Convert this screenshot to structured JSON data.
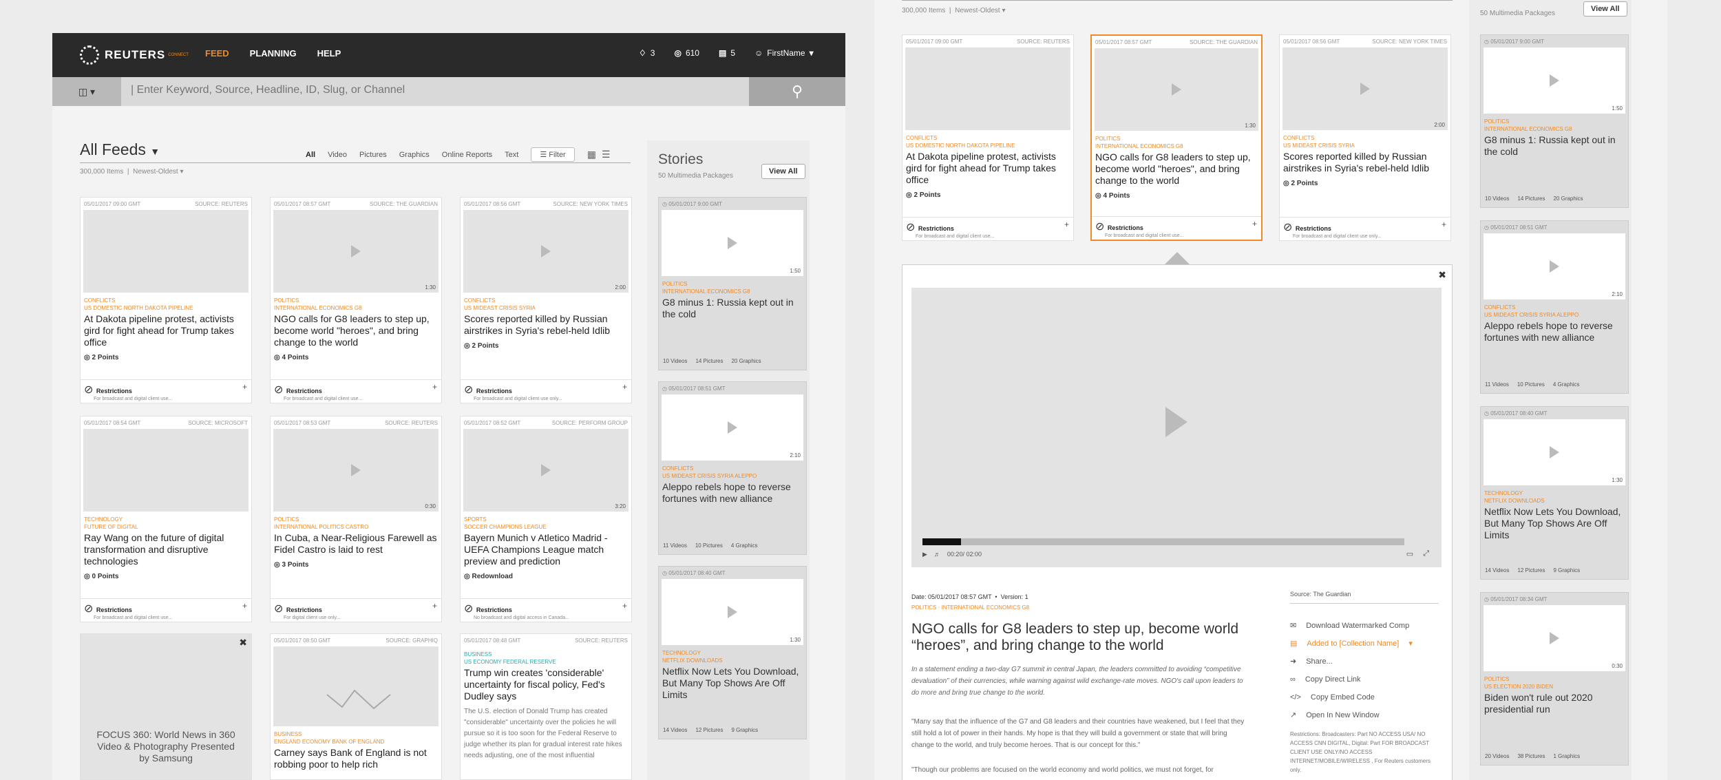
{
  "nav": {
    "brand": "REUTERS",
    "brand_sub": "CONNECT",
    "links": [
      "FEED",
      "PLANNING",
      "HELP"
    ],
    "notifications": "3",
    "points": "610",
    "packages": "5",
    "user": "FirstName"
  },
  "search": {
    "placeholder": "| Enter Keyword, Source, Headline, ID, Slug, or Channel"
  },
  "feed": {
    "title": "All Feeds",
    "count": "300,000 Items",
    "sort": "Newest-Oldest",
    "filters": [
      "All",
      "Video",
      "Pictures",
      "Graphics",
      "Online Reports",
      "Text"
    ],
    "filter_button": "Filter"
  },
  "cards": [
    {
      "date": "05/01/2017 09:00 GMT",
      "source": "SOURCE: REUTERS",
      "cat1": "CONFLICTS",
      "cat2": "US DOMESTIC NORTH DAKOTA PIPELINE",
      "title": "At Dakota pipeline protest, activists gird for fight ahead for Trump takes office",
      "points": "2 Points",
      "restr": "Restrictions",
      "restr_sub": "For broadcast and digital client use...",
      "dur": ""
    },
    {
      "date": "05/01/2017 08:57 GMT",
      "source": "SOURCE: THE GUARDIAN",
      "cat1": "POLITICS",
      "cat2": "INTERNATIONAL ECONOMICS G8",
      "title": "NGO calls for G8 leaders to step up, become world \"heroes\", and bring change to the world",
      "points": "4 Points",
      "restr": "Restrictions",
      "restr_sub": "For broadcast and digital client use...",
      "dur": "1:30"
    },
    {
      "date": "05/01/2017 08:56 GMT",
      "source": "SOURCE: NEW YORK TIMES",
      "cat1": "CONFLICTS",
      "cat2": "US MIDEAST CRISIS SYRIA",
      "title": "Scores reported killed by Russian airstrikes in Syria's rebel-held Idlib",
      "points": "2 Points",
      "restr": "Restrictions",
      "restr_sub": "For broadcast and digital client use only...",
      "dur": "2:00"
    },
    {
      "date": "05/01/2017 08:54 GMT",
      "source": "SOURCE: MICROSOFT",
      "cat1": "TECHNOLOGY",
      "cat2": "FUTURE OF DIGITAL",
      "title": "Ray Wang on the future of digital transformation and disruptive technologies",
      "points": "0 Points",
      "restr": "Restrictions",
      "restr_sub": "For broadcast and digital client use...",
      "dur": ""
    },
    {
      "date": "05/01/2017 08:53 GMT",
      "source": "SOURCE: REUTERS",
      "cat1": "POLITICS",
      "cat2": "INTERNATIONAL POLITICS CASTRO",
      "title": "In Cuba, a Near-Religious Farewell as Fidel Castro is laid to rest",
      "points": "3 Points",
      "restr": "Restrictions",
      "restr_sub": "For digital client use only...",
      "dur": "0:30"
    },
    {
      "date": "05/01/2017 08:52 GMT",
      "source": "SOURCE: PERFORM GROUP",
      "cat1": "SPORTS",
      "cat2": "SOCCER CHAMPIONS LEAGUE",
      "title": "Bayern Munich v Atletico Madrid - UEFA Champions League match preview and prediction",
      "points": "Redownload",
      "restr": "Restrictions",
      "restr_sub": "No broadcast and digital access in Canada...",
      "dur": "3:20"
    }
  ],
  "row3": {
    "focus": "FOCUS 360: World News in 360 Video & Photography Presented by Samsung",
    "c2_date": "05/01/2017 08:50 GMT",
    "c2_source": "SOURCE: GRAPHIQ",
    "c2_cat1": "BUSINESS",
    "c2_cat2": "ENGLAND ECONOMY BANK OF ENGLAND",
    "c2_title": "Carney says Bank of England is not robbing poor to help rich",
    "c3_date": "05/01/2017 08:48 GMT",
    "c3_source": "SOURCE: REUTERS",
    "c3_cat1": "BUSINESS",
    "c3_cat2": "US ECONOMY FEDERAL RESERVE",
    "c3_title": "Trump win creates 'considerable' uncertainty for fiscal policy, Fed's Dudley says",
    "c3_body": "The U.S. election of Donald Trump has created \"considerable\" uncertainty over the policies he will pursue so it is too soon for the Federal Reserve to judge whether its plan for gradual interest rate hikes needs adjusting, one of the most influential"
  },
  "stories": {
    "title": "Stories",
    "sub": "50 Multimedia Packages",
    "view_all": "View All",
    "items": [
      {
        "date": "05/01/2017 9:00 GMT",
        "dur": "1:50",
        "cat1": "POLITICS",
        "cat2": "INTERNATIONAL ECONOMICS G8",
        "title": "G8 minus 1: Russia kept out in the cold",
        "v": "10 Videos",
        "p": "14 Pictures",
        "g": "20 Graphics"
      },
      {
        "date": "05/01/2017 08:51 GMT",
        "dur": "2:10",
        "cat1": "CONFLICTS",
        "cat2": "US MIDEAST CRISIS SYRIA ALEPPO",
        "title": "Aleppo rebels hope to reverse fortunes with new alliance",
        "v": "11 Videos",
        "p": "10 Pictures",
        "g": "4 Graphics"
      },
      {
        "date": "05/01/2017 08:40 GMT",
        "dur": "1:30",
        "cat1": "TECHNOLOGY",
        "cat2": "NETFLIX DOWNLOADS",
        "title": "Netflix Now Lets You Download, But Many Top Shows Are Off Limits",
        "v": "14 Videos",
        "p": "12 Pictures",
        "g": "9 Graphics"
      },
      {
        "date": "05/01/2017 08:34 GMT",
        "dur": "0:30",
        "cat1": "POLITICS",
        "cat2": "US ELECTION 2020 BIDEN",
        "title": "Biden won't rule out 2020 presidential run",
        "v": "20 Videos",
        "p": "38 Pictures",
        "g": "1 Graphics"
      }
    ]
  },
  "detail": {
    "time": "00:20/ 02:00",
    "progress": 0.08,
    "date": "Date: 05/01/2017 08:57 GMT",
    "version": "Version: 1",
    "cats": "POLITICS · INTERNATIONAL ECONOMICS G8",
    "title": "NGO calls for G8 leaders to step up, become world “heroes”, and bring change to the world",
    "summary": "In a statement ending a two-day G7 summit in central Japan, the leaders committed to avoiding “competitive devaluation” of their currencies, while warning against wild exchange-rate moves. NGO's call upon leaders to do more and bring true change to the world.",
    "p1": "\"Many say that the influence of the G7 and G8 leaders and their countries have weakened, but I feel that they still hold a lot of power in their hands. My hope is that they will build a government or state that will bring change to the world, and truly become heroes. That is our concept for this.\"",
    "p2": "\"Though our problems are focused on the world economy and world politics, we must not forget, for",
    "source": "Source: The Guardian",
    "actions": [
      "Download Watermarked Comp",
      "Added to [Collection Name]",
      "Share...",
      "Copy Direct Link",
      "Copy Embed Code",
      "Open In New Window"
    ],
    "restrictions": "Restrictions: Broadcasters: Part NO ACCESS USA/ NO ACCESS CNN DIGITAL, Digital: Part FOR BROADCAST CLIENT USE ONLY/NO ACCESS INTERNET/MOBILE/WIRELESS , For Reuters customers only."
  }
}
